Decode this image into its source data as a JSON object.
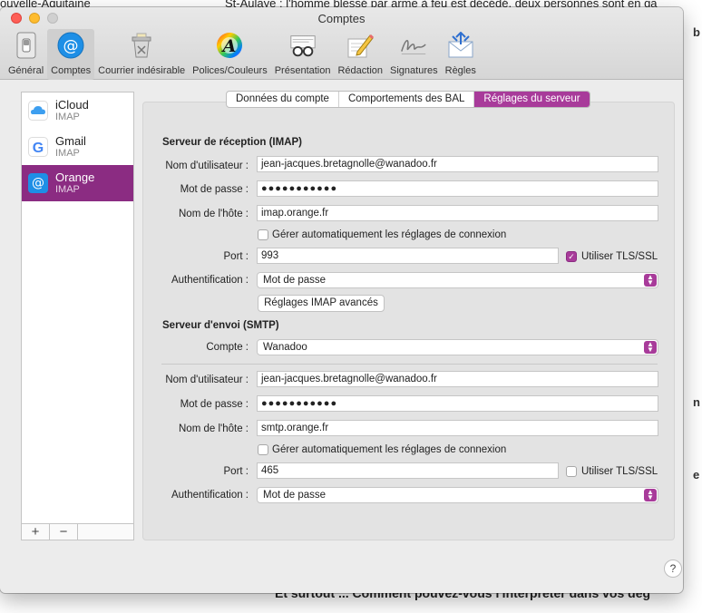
{
  "background": {
    "top_left": "ouvelle-Aquitaine",
    "top_right": "St-Aulaye : l'homme blessé par arme à feu est décédé, deux personnes sont en ga",
    "bottom": "Et surtout ... Comment pouvez-vous l'interpréter dans vos deg",
    "frag_b": "b",
    "frag_n": "n",
    "frag_e": "e"
  },
  "window": {
    "title": "Comptes"
  },
  "toolbar": {
    "items": [
      {
        "label": "Général",
        "icon": "general-switch-icon"
      },
      {
        "label": "Comptes",
        "icon": "at-sign-icon"
      },
      {
        "label": "Courrier indésirable",
        "icon": "junk-trash-icon"
      },
      {
        "label": "Polices/Couleurs",
        "icon": "font-color-icon"
      },
      {
        "label": "Présentation",
        "icon": "glasses-icon"
      },
      {
        "label": "Rédaction",
        "icon": "pencil-icon"
      },
      {
        "label": "Signatures",
        "icon": "signature-icon"
      },
      {
        "label": "Règles",
        "icon": "rules-envelope-icon"
      }
    ]
  },
  "sidebar": {
    "accounts": [
      {
        "name": "iCloud",
        "type": "IMAP"
      },
      {
        "name": "Gmail",
        "type": "IMAP"
      },
      {
        "name": "Orange",
        "type": "IMAP"
      }
    ],
    "add_label": "+",
    "remove_label": "−"
  },
  "tabs": [
    "Données du compte",
    "Comportements des BAL",
    "Réglages du serveur"
  ],
  "incoming": {
    "title": "Serveur de réception (IMAP)",
    "username_label": "Nom d'utilisateur :",
    "username": "jean-jacques.bretagnolle@wanadoo.fr",
    "password_label": "Mot de passe :",
    "password": "●●●●●●●●●●●",
    "host_label": "Nom de l'hôte :",
    "host": "imap.orange.fr",
    "auto_label": "Gérer automatiquement les réglages de connexion",
    "port_label": "Port :",
    "port": "993",
    "tls_label": "Utiliser TLS/SSL",
    "auth_label": "Authentification :",
    "auth": "Mot de passe",
    "advanced_button": "Réglages IMAP avancés"
  },
  "outgoing": {
    "title": "Serveur d'envoi (SMTP)",
    "account_label": "Compte :",
    "account": "Wanadoo",
    "username_label": "Nom d'utilisateur :",
    "username": "jean-jacques.bretagnolle@wanadoo.fr",
    "password_label": "Mot de passe :",
    "password": "●●●●●●●●●●●",
    "host_label": "Nom de l'hôte :",
    "host": "smtp.orange.fr",
    "auto_label": "Gérer automatiquement les réglages de connexion",
    "port_label": "Port :",
    "port": "465",
    "tls_label": "Utiliser TLS/SSL",
    "auth_label": "Authentification :",
    "auth": "Mot de passe"
  },
  "help_label": "?",
  "colors": {
    "accent": "#a83b9a",
    "selected_row": "#8b2c82"
  }
}
